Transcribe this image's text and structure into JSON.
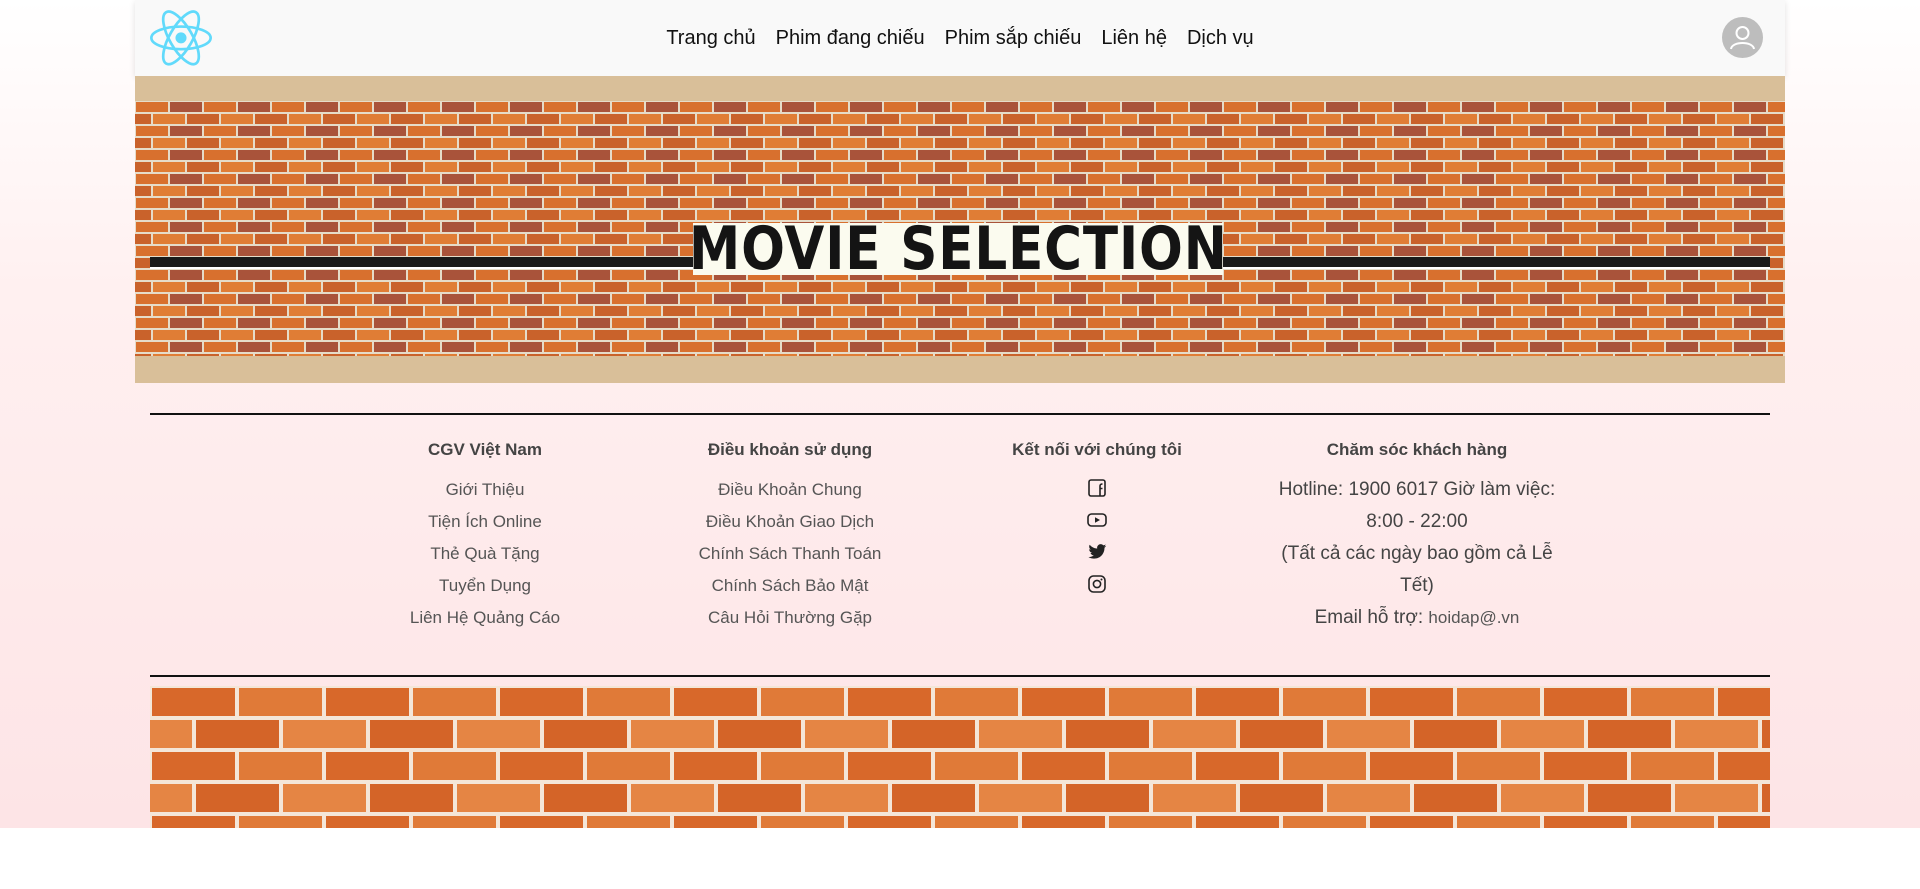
{
  "nav": {
    "items": [
      {
        "label": "Trang chủ"
      },
      {
        "label": "Phim đang chiếu"
      },
      {
        "label": "Phim sắp chiếu"
      },
      {
        "label": "Liên hệ"
      },
      {
        "label": "Dịch vụ"
      }
    ]
  },
  "banner": {
    "title": "MOVIE SELECTION"
  },
  "footer": {
    "cgv": {
      "heading": "CGV Việt Nam",
      "links": [
        "Giới Thiệu",
        "Tiện Ích Online",
        "Thẻ Quà Tặng",
        "Tuyển Dụng",
        "Liên Hệ Quảng Cáo"
      ]
    },
    "terms": {
      "heading": "Điều khoản sử dụng",
      "links": [
        "Điều Khoản Chung",
        "Điều Khoản Giao Dịch",
        "Chính Sách Thanh Toán",
        "Chính Sách Bảo Mật",
        "Câu Hỏi Thường Gặp"
      ]
    },
    "connect": {
      "heading": "Kết nối với chúng tôi",
      "icons": [
        "facebook-icon",
        "youtube-icon",
        "twitter-icon",
        "instagram-icon"
      ]
    },
    "care": {
      "heading": "Chăm sóc khách hàng",
      "hotline": "Hotline: 1900 6017 Giờ làm việc: 8:00 - 22:00",
      "days": "(Tất cả các ngày bao gồm cả Lễ Tết)",
      "email_label": "Email hỗ trợ: ",
      "email": "hoidap@.vn"
    }
  },
  "colors": {
    "header_bg": "#f9f9f9",
    "logo": "#61dafb",
    "brick": "#d8702e",
    "banner_frame": "#d9bf99"
  }
}
